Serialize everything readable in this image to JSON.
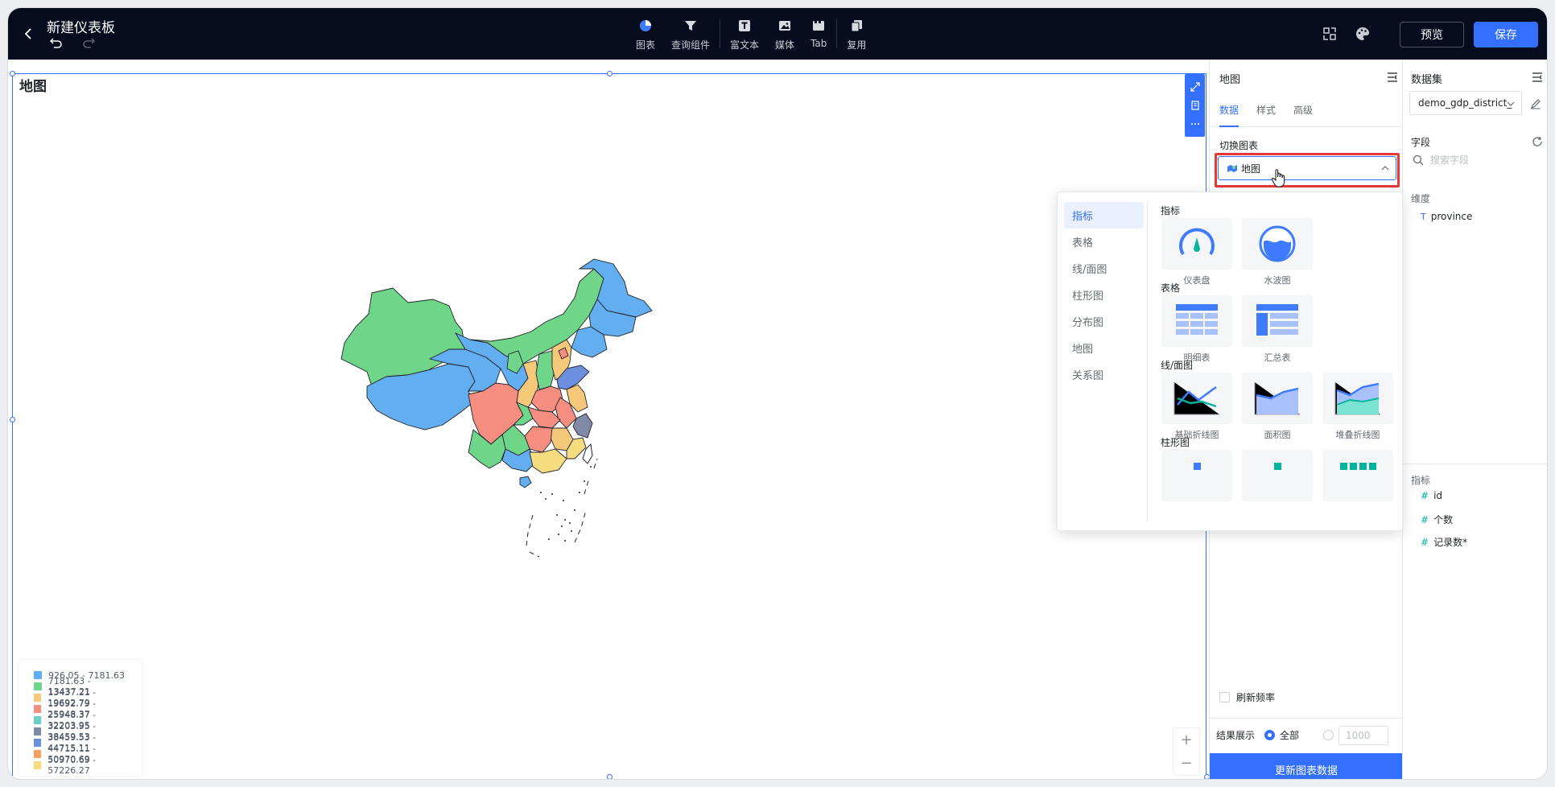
{
  "header": {
    "title": "新建仪表板",
    "toolbar": [
      {
        "label": "图表",
        "icon": "pie-chart-icon"
      },
      {
        "label": "查询组件",
        "icon": "filter-icon"
      },
      {
        "label": "富文本",
        "icon": "text-icon"
      },
      {
        "label": "媒体",
        "icon": "image-icon"
      },
      {
        "label": "Tab",
        "icon": "tab-icon"
      },
      {
        "label": "复用",
        "icon": "copy-icon"
      }
    ],
    "preview_label": "预览",
    "save_label": "保存"
  },
  "canvas": {
    "chart_title": "地图",
    "legend": [
      {
        "label": "926.05 - 7181.63",
        "color": "#62aef0"
      },
      {
        "label": "7181.63 - 13437.21",
        "color": "#6fd689"
      },
      {
        "label": "13437.21 - 19692.79",
        "color": "#f6c97a"
      },
      {
        "label": "19692.79 - 25948.37",
        "color": "#f58e80"
      },
      {
        "label": "25948.37 - 32203.95",
        "color": "#6ccfc3"
      },
      {
        "label": "32203.95 - 38459.53",
        "color": "#7f8aa6"
      },
      {
        "label": "38459.53 - 44715.11",
        "color": "#6d8fe0"
      },
      {
        "label": "44715.11 - 50970.69",
        "color": "#f3a060"
      },
      {
        "label": "50970.69 - 57226.27",
        "color": "#f5dc7e"
      }
    ],
    "zoom_in": "+",
    "zoom_out": "−"
  },
  "properties": {
    "panel_title": "地图",
    "tabs": [
      "数据",
      "样式",
      "高级"
    ],
    "switch_chart_label": "切换图表",
    "selected_chart": "地图",
    "refresh_label": "刷新频率",
    "result_label": "结果展示",
    "result_all": "全部",
    "result_limit": "1000",
    "update_button": "更新图表数据"
  },
  "chart_picker": {
    "categories": [
      "指标",
      "表格",
      "线/面图",
      "柱形图",
      "分布图",
      "地图",
      "关系图"
    ],
    "groups": [
      {
        "title": "指标",
        "items": [
          "仪表盘",
          "水波图"
        ]
      },
      {
        "title": "表格",
        "items": [
          "明细表",
          "汇总表"
        ]
      },
      {
        "title": "线/面图",
        "items": [
          "基础折线图",
          "面积图",
          "堆叠折线图"
        ]
      },
      {
        "title": "柱形图",
        "items": [
          "",
          "",
          ""
        ]
      }
    ]
  },
  "dataset": {
    "panel_title": "数据集",
    "selected": "demo_gdp_district_",
    "fields_label": "字段",
    "search_placeholder": "搜索字段",
    "dimension_label": "维度",
    "dimensions": [
      "province"
    ],
    "measure_label": "指标",
    "measures": [
      "id",
      "个数",
      "记录数*"
    ]
  },
  "colors": {
    "accent": "#3370ff",
    "topbar": "#050c1d",
    "highlight": "#e53935"
  }
}
